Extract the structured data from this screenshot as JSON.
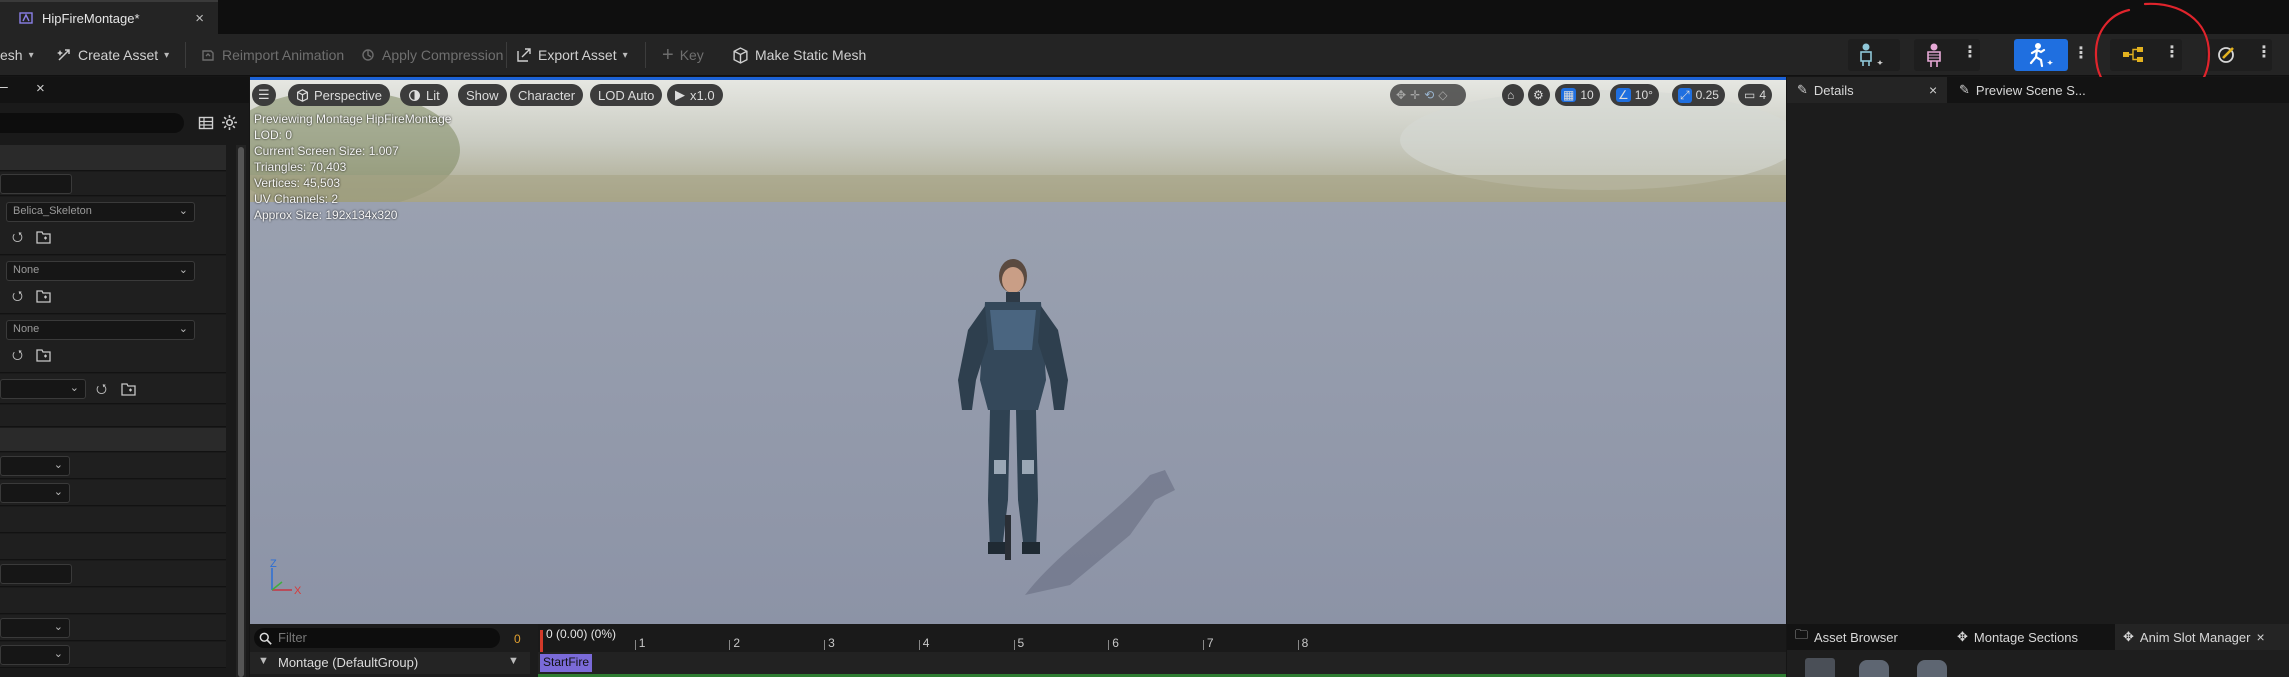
{
  "document_tab": {
    "title": "HipFireMontage*",
    "close": "×"
  },
  "toolbar": {
    "cut_label": "esh",
    "create_asset": "Create Asset",
    "reimport_animation": "Reimport Animation",
    "apply_compression": "Apply Compression",
    "export_asset": "Export Asset",
    "key": "Key",
    "make_static_mesh": "Make Static Mesh",
    "more": "⋮"
  },
  "left_panel": {
    "close": "×",
    "skeleton_value": "Belica_Skeleton",
    "none_1": "None",
    "none_2": "None"
  },
  "viewport": {
    "menu_icon": "hamburger-icon",
    "perspective": "Perspective",
    "lit": "Lit",
    "show": "Show",
    "character": "Character",
    "lod": "LOD Auto",
    "play_speed": "x1.0",
    "grid_size": "10",
    "rotation_snap": "10°",
    "scale_snap": "0.25",
    "camera_speed": "4",
    "stats": {
      "line1": "Previewing Montage HipFireMontage",
      "line2": "LOD: 0",
      "line3": "Current Screen Size: 1.007",
      "line4": "Triangles: 70,403",
      "line5": "Vertices: 45,503",
      "line6": "UV Channels: 2",
      "line7": "Approx Size: 192x134x320"
    },
    "axis_z": "Z",
    "axis_x": "X"
  },
  "timeline": {
    "filter_placeholder": "Filter",
    "frame_count": "0",
    "current_time": "0 (0.00) (0%)",
    "ticks": [
      "1",
      "2",
      "3",
      "4",
      "5",
      "6",
      "7",
      "8"
    ],
    "montage_group": "Montage (DefaultGroup)",
    "section": "StartFire"
  },
  "right_panel": {
    "details_tab": "Details",
    "details_close": "×",
    "preview_scene_tab": "Preview Scene S...",
    "asset_browser_tab": "Asset Browser",
    "montage_sections_tab": "Montage Sections",
    "anim_slot_manager_tab": "Anim Slot Manager",
    "anim_slot_close": "×"
  },
  "colors": {
    "accent_blue": "#1c62d6",
    "annotation_red": "#e0242c",
    "section_purple": "#7a6ad8",
    "timeline_green": "#2e7d32"
  }
}
